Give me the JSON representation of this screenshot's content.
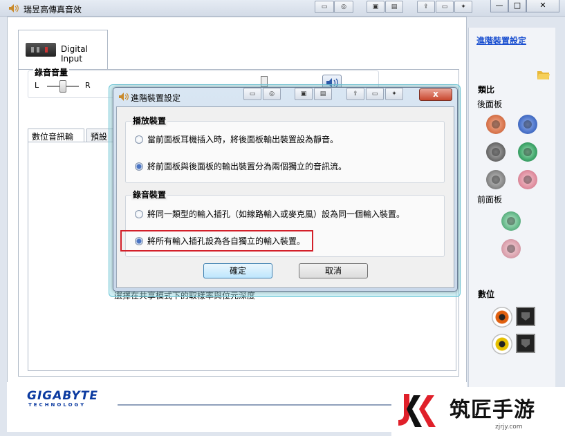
{
  "window": {
    "title": "瑞昱高傳真音效",
    "controls": {
      "minimize": "—",
      "maximize": "□",
      "close": "✕"
    }
  },
  "tab": {
    "label": "Digital Input"
  },
  "volume": {
    "title": "錄音音量",
    "left": "L",
    "right": "R"
  },
  "subtabs": [
    "數位音訊輸入",
    "預設格"
  ],
  "bgtext": "選擇在共享模式下的取樣率與位元深度",
  "right_panel": {
    "adv_link": "進階裝置設定",
    "analog": "類比",
    "rear": "後面板",
    "front": "前面板",
    "digital": "數位"
  },
  "brand": {
    "name": "GIGABYTE",
    "sub": "TECHNOLOGY"
  },
  "dialog": {
    "title": "進階裝置設定",
    "close": "x",
    "playback": {
      "title": "播放裝置",
      "opt1": "當前面板耳機插入時，將後面板輸出裝置設為靜音。",
      "opt2": "將前面板與後面板的輸出裝置分為兩個獨立的音訊流。",
      "selected": 2
    },
    "record": {
      "title": "錄音裝置",
      "opt1": "將同一類型的輸入插孔（如線路輸入或麥克風）設為同一個輸入裝置。",
      "opt2": "將所有輸入插孔設為各自獨立的輸入裝置。",
      "selected": 2
    },
    "ok": "確定",
    "cancel": "取消"
  },
  "watermark": {
    "text": "筑匠手游",
    "url": "zjrjy.com",
    "logo": "JK"
  },
  "colors": {
    "jack_orange": "#e07a4f",
    "jack_blue": "#4a72c9",
    "jack_gray": "#6f6f6f",
    "jack_green": "#3fa66a",
    "jack_pink": "#e08fa0",
    "link": "#1a4fd0",
    "highlight": "#d3202a"
  }
}
